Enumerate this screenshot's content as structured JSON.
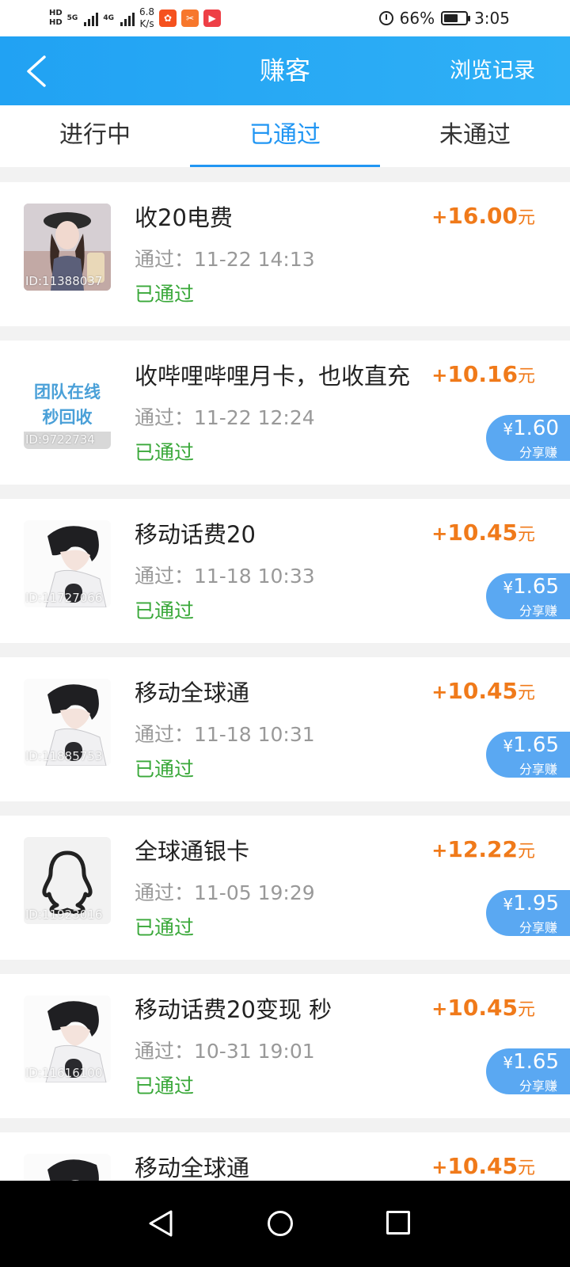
{
  "status_bar": {
    "hd1": "HD",
    "hd2": "HD",
    "net1": "5G",
    "net2": "4G",
    "speed_value": "6.8",
    "speed_unit": "K/s",
    "battery": "66%",
    "battery_level": 0.66,
    "time": "3:05"
  },
  "header": {
    "title": "赚客",
    "history_link": "浏览记录"
  },
  "tabs": [
    {
      "label": "进行中"
    },
    {
      "label": "已通过"
    },
    {
      "label": "未通过"
    }
  ],
  "active_tab": "已通过",
  "tasks": [
    {
      "id": "ID:11388037",
      "name": "收20电费",
      "date": "通过：11-22 14:13",
      "status": "已通过",
      "plus": "+",
      "amount": "16.00",
      "unit": "元",
      "share": null
    },
    {
      "id": "ID:9722734",
      "thumb_text_1": "团队在线",
      "thumb_text_2": "秒回收",
      "name": "收哔哩哔哩月卡，也收直充",
      "date": "通过：11-22 12:24",
      "status": "已通过",
      "plus": "+",
      "amount": "10.16",
      "unit": "元",
      "share": {
        "yen": "¥",
        "value": "1.60",
        "label": "分享赚"
      }
    },
    {
      "id": "ID:11727066",
      "name": "移动话费20",
      "date": "通过：11-18 10:33",
      "status": "已通过",
      "plus": "+",
      "amount": "10.45",
      "unit": "元",
      "share": {
        "yen": "¥",
        "value": "1.65",
        "label": "分享赚"
      }
    },
    {
      "id": "ID:11885753",
      "name": "移动全球通",
      "date": "通过：11-18 10:31",
      "status": "已通过",
      "plus": "+",
      "amount": "10.45",
      "unit": "元",
      "share": {
        "yen": "¥",
        "value": "1.65",
        "label": "分享赚"
      }
    },
    {
      "id": "ID:11923016",
      "name": "全球通银卡",
      "date": "通过：11-05 19:29",
      "status": "已通过",
      "plus": "+",
      "amount": "12.22",
      "unit": "元",
      "share": {
        "yen": "¥",
        "value": "1.95",
        "label": "分享赚"
      }
    },
    {
      "id": "ID:11616100",
      "name": "移动话费20变现 秒",
      "date": "通过：10-31 19:01",
      "status": "已通过",
      "plus": "+",
      "amount": "10.45",
      "unit": "元",
      "share": {
        "yen": "¥",
        "value": "1.65",
        "label": "分享赚"
      }
    },
    {
      "id": "",
      "name": "移动全球通",
      "date": "",
      "status": "",
      "plus": "+",
      "amount": "10.45",
      "unit": "元",
      "share": null
    }
  ],
  "colors": {
    "header_blue": "#21a2f3",
    "active_tab": "#2196f3",
    "reward_orange": "#f07a1a",
    "status_green": "#3aa83a",
    "share_badge": "#5aa8f2"
  },
  "icons": [
    "back-arrow-icon",
    "alarm-icon",
    "battery-icon",
    "signal-icon",
    "qq-penguin-icon",
    "nav-back-icon",
    "nav-home-icon",
    "nav-recent-icon"
  ]
}
